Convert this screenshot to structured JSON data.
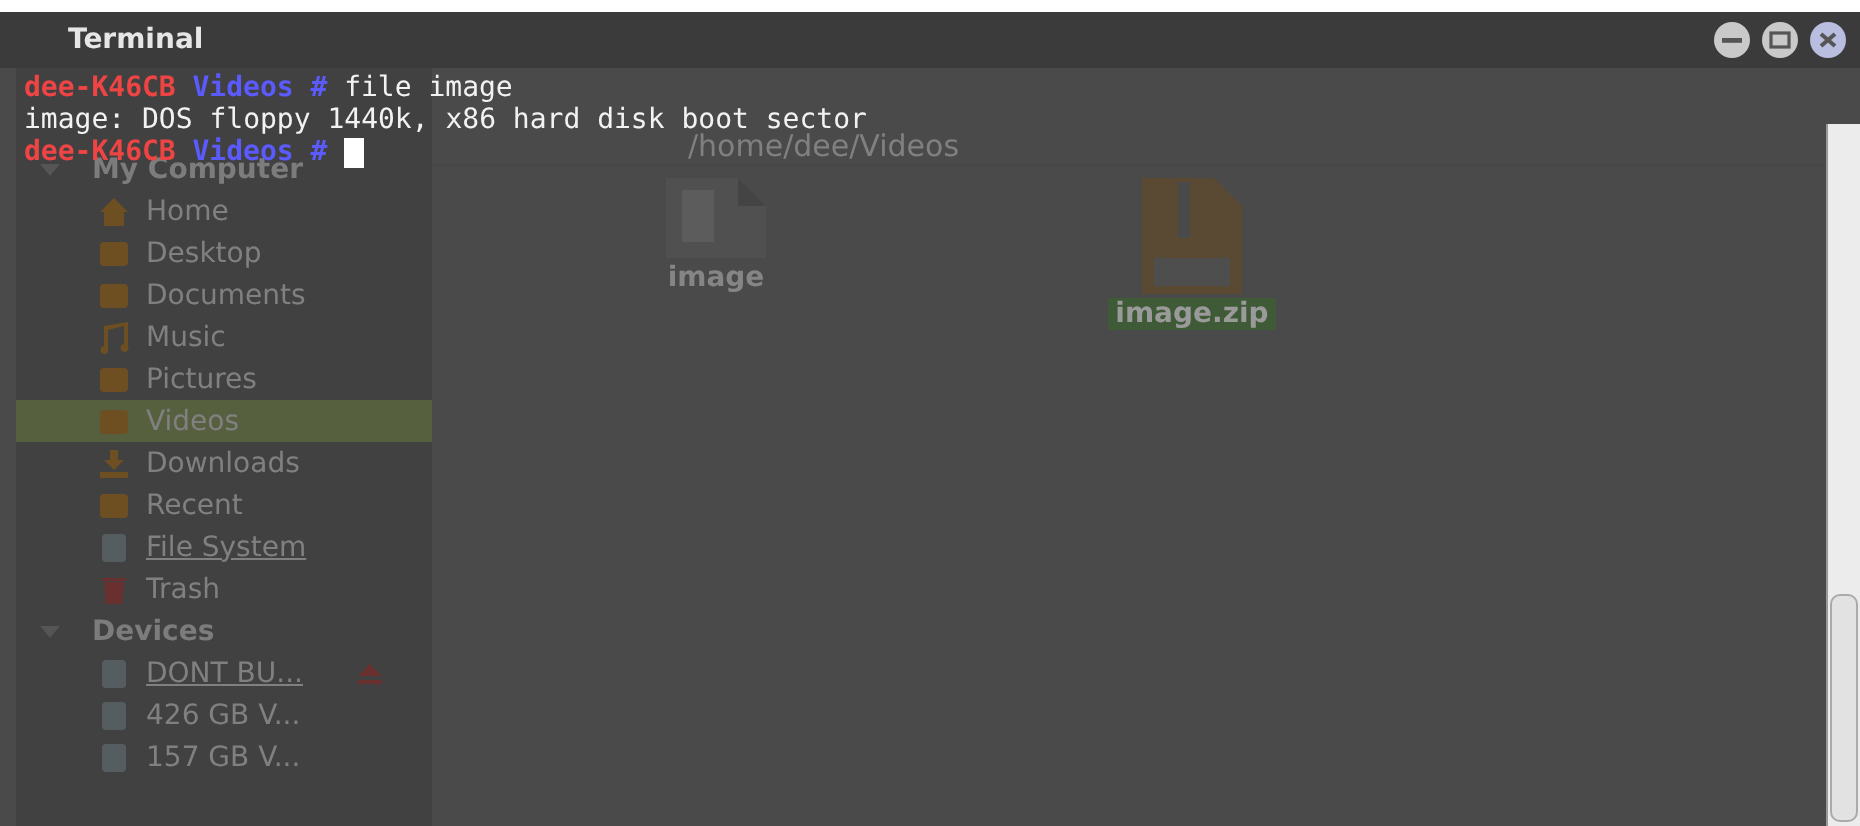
{
  "window": {
    "title": "Terminal"
  },
  "terminal_lines": [
    {
      "kind": "prompt",
      "user": "dee-K46CB",
      "directory": "Videos #",
      "command": "file image",
      "cursor": false
    },
    {
      "kind": "output",
      "text": "image: DOS floppy 1440k, x86 hard disk boot sector"
    },
    {
      "kind": "prompt",
      "user": "dee-K46CB",
      "directory": "Videos #",
      "cursor": true
    }
  ],
  "file_manager": {
    "path": "/home/dee/Videos",
    "sidebar": [
      {
        "title": "My Computer",
        "expanded": true,
        "items": [
          {
            "label": "Home",
            "kind": "home",
            "selected": false,
            "underlined": false,
            "ejectable": false
          },
          {
            "label": "Desktop",
            "kind": "desktop",
            "selected": false,
            "underlined": false,
            "ejectable": false
          },
          {
            "label": "Documents",
            "kind": "document",
            "selected": false,
            "underlined": false,
            "ejectable": false
          },
          {
            "label": "Music",
            "kind": "music",
            "selected": false,
            "underlined": false,
            "ejectable": false
          },
          {
            "label": "Pictures",
            "kind": "picture",
            "selected": false,
            "underlined": false,
            "ejectable": false
          },
          {
            "label": "Videos",
            "kind": "video",
            "selected": true,
            "underlined": false,
            "ejectable": false
          },
          {
            "label": "Downloads",
            "kind": "download",
            "selected": false,
            "underlined": false,
            "ejectable": false
          },
          {
            "label": "Recent",
            "kind": "recent",
            "selected": false,
            "underlined": false,
            "ejectable": false
          },
          {
            "label": "File System",
            "kind": "drive",
            "selected": false,
            "underlined": true,
            "ejectable": false
          },
          {
            "label": "Trash",
            "kind": "trash",
            "selected": false,
            "underlined": false,
            "ejectable": false
          }
        ]
      },
      {
        "title": "Devices",
        "expanded": true,
        "items": [
          {
            "label": "DONT BU...",
            "kind": "drive",
            "selected": false,
            "underlined": true,
            "ejectable": true
          },
          {
            "label": "426 GB V...",
            "kind": "drive",
            "selected": false,
            "underlined": false,
            "ejectable": false
          },
          {
            "label": "157 GB V...",
            "kind": "drive",
            "selected": false,
            "underlined": false,
            "ejectable": false
          }
        ]
      }
    ],
    "files": [
      {
        "name": "image",
        "kind": "binary",
        "selected": false
      },
      {
        "name": "image.zip",
        "kind": "zip",
        "selected": true
      }
    ]
  }
}
